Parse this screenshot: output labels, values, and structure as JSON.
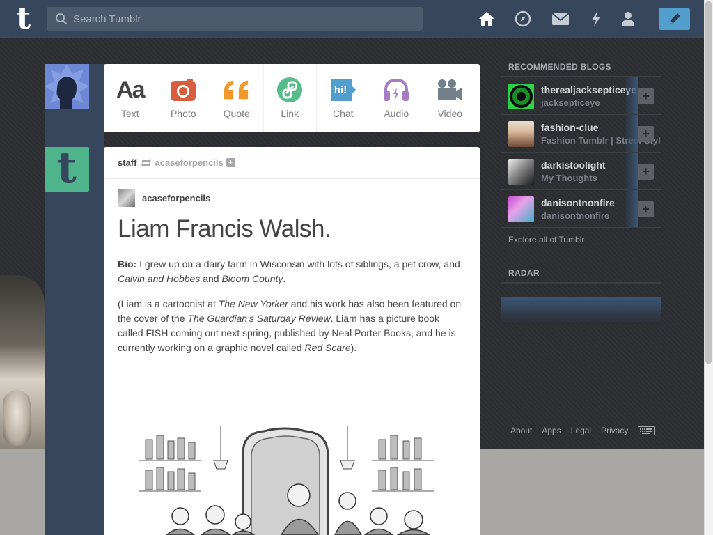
{
  "header": {
    "logo": "t",
    "search_placeholder": "Search Tumblr"
  },
  "post_types": [
    {
      "label": "Text",
      "icon": "text-icon",
      "color": "#444444"
    },
    {
      "label": "Photo",
      "icon": "camera-icon",
      "color": "#d95e40"
    },
    {
      "label": "Quote",
      "icon": "quote-icon",
      "color": "#f2992e"
    },
    {
      "label": "Link",
      "icon": "link-icon",
      "color": "#56bc8a"
    },
    {
      "label": "Chat",
      "icon": "chat-icon",
      "color": "#529ecc"
    },
    {
      "label": "Audio",
      "icon": "headphones-icon",
      "color": "#a77dc2"
    },
    {
      "label": "Video",
      "icon": "video-camera-icon",
      "color": "#748089"
    }
  ],
  "staff_avatar_letter": "t",
  "post": {
    "reblog_user": "staff",
    "reblog_from": "acaseforpencils",
    "follow_plus": "+",
    "author": "acaseforpencils",
    "title": "Liam Francis Walsh.",
    "bio_label": "Bio:",
    "bio_text_1": " I grew up on a dairy farm in Wisconsin with lots of siblings, a pet crow, and ",
    "bio_italic_1": "Calvin and Hobbes",
    "bio_text_2": " and ",
    "bio_italic_2": "Bloom County",
    "bio_text_3": ".",
    "p2_1": "(Liam is a cartoonist at ",
    "p2_italic_1": "The New Yorker",
    "p2_2": " and his work has also been featured on the cover of the ",
    "p2_link": "The Guardian’s Saturday Review",
    "p2_3": ". Liam has a picture book called FISH coming out next spring, published by Neal Porter Books, and he is currently working on a graphic novel called ",
    "p2_italic_2": "Red Scare",
    "p2_4": ")."
  },
  "sidebar": {
    "recommended_heading": "RECOMMENDED BLOGS",
    "blogs": [
      {
        "name": "therealjacksepticeye",
        "subtitle": "jacksepticeye",
        "avatar_colors": [
          "#1c8f2a",
          "#0b0b0b"
        ]
      },
      {
        "name": "fashion-clue",
        "subtitle": "Fashion Tumblr | Street Style",
        "avatar_colors": [
          "#d9b99b",
          "#6e4a33"
        ]
      },
      {
        "name": "darkistoolight",
        "subtitle": "My Thoughts",
        "avatar_colors": [
          "#d8d8d8",
          "#222222"
        ]
      },
      {
        "name": "danisontnonfire",
        "subtitle": "danisontnonfire",
        "avatar_colors": [
          "#c94fd0",
          "#3fb0c9"
        ]
      }
    ],
    "follow_label": "+",
    "explore_link": "Explore all of Tumblr",
    "radar_heading": "RADAR"
  },
  "footer": {
    "links": [
      "About",
      "Apps",
      "Legal",
      "Privacy"
    ]
  },
  "colors": {
    "header_bg": "#36465d",
    "accent_blue": "#529ecc",
    "dashboard_bg": "#2b2d31"
  }
}
